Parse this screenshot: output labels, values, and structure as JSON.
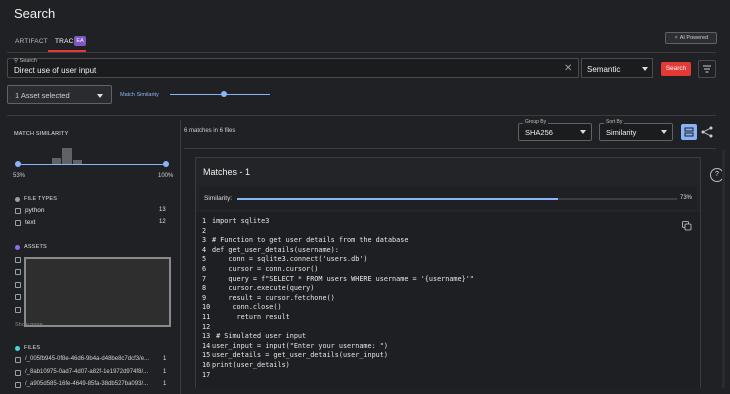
{
  "header": {
    "title": "Search",
    "ai_label": "AI Powered"
  },
  "tabs": [
    {
      "label": "ARTIFACT"
    },
    {
      "label": "TRACE",
      "badge": "EA"
    }
  ],
  "search": {
    "label": "Search",
    "value": "Direct use of user input",
    "mode": "Semantic",
    "button": "Search"
  },
  "filters": {
    "asset_select": "1 Asset selected",
    "match_similarity_label": "Match Similarity"
  },
  "sidebar": {
    "match_similarity_title": "MATCH SIMILARITY",
    "range_min": "53%",
    "range_max": "100%",
    "file_types_title": "FILE TYPES",
    "file_types": [
      {
        "label": "python",
        "count": "13"
      },
      {
        "label": "text",
        "count": "12"
      }
    ],
    "assets_title": "ASSETS",
    "show_more": "Show more",
    "files_title": "FILES",
    "files": [
      {
        "label": "/_005fb945-0f8e-46d6-9b4a-d48be8c7dcf3/e...",
        "count": "1"
      },
      {
        "label": "/_8ab10975-0ad7-4d07-a82f-1e1972d974f8/...",
        "count": "1"
      },
      {
        "label": "/_a905d585-16fe-4649-85fa-38db527ba093/...",
        "count": "1"
      }
    ],
    "colors": {
      "file_types_dot": "#9aa0a6",
      "assets_dot": "#8e6cf0",
      "files_dot": "#4dd0e1"
    }
  },
  "results": {
    "count_text": "6 matches in 6 files",
    "group_by_label": "Group By",
    "group_by_value": "SHA256",
    "sort_by_label": "Sort By",
    "sort_by_value": "Similarity",
    "panel_title": "Matches - 1",
    "similarity_label": "Similarity:",
    "similarity_value": "73%",
    "similarity_fraction": 0.73,
    "code_lines": [
      "import sqlite3",
      "",
      "# Function to get user details from the database",
      "def get_user_details(username):",
      "    conn = sqlite3.connect('users.db')",
      "    cursor = conn.cursor()",
      "    query = f\"SELECT * FROM users WHERE username = '{username}'\"",
      "    cursor.execute(query)",
      "    result = cursor.fetchone()",
      "     conn.close()",
      "      return result",
      "",
      " # Simulated user input",
      "user_input = input(\"Enter your username: \")",
      "user_details = get_user_details(user_input)",
      "print(user_details)",
      ""
    ]
  },
  "accent": "#e53935",
  "highlight": "#8ab4f8"
}
